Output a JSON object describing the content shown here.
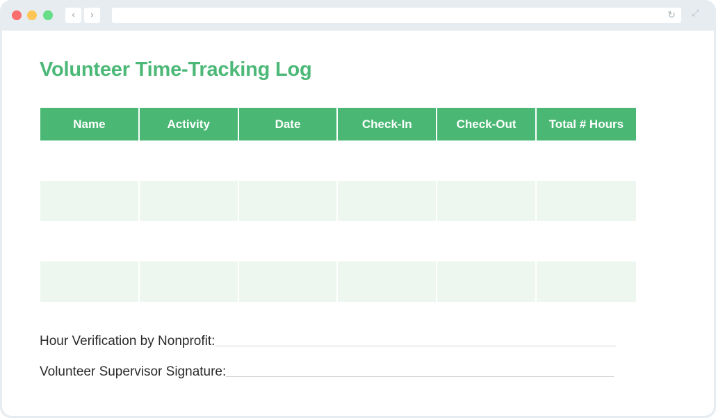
{
  "browser": {
    "back_icon": "‹",
    "forward_icon": "›",
    "reload_icon": "↻",
    "expand_icon": "⤢",
    "url": ""
  },
  "document": {
    "title": "Volunteer Time-Tracking Log",
    "accent_color": "#4ab874",
    "table": {
      "columns": [
        "Name",
        "Activity",
        "Date",
        "Check-In",
        "Check-Out",
        "Total # Hours"
      ],
      "rows": [
        [
          "",
          "",
          "",
          "",
          "",
          ""
        ],
        [
          "",
          "",
          "",
          "",
          "",
          ""
        ],
        [
          "",
          "",
          "",
          "",
          "",
          ""
        ],
        [
          "",
          "",
          "",
          "",
          "",
          ""
        ]
      ]
    },
    "signatures": [
      {
        "label": "Hour Verification by Nonprofit:"
      },
      {
        "label": "Volunteer Supervisor Signature:"
      }
    ]
  }
}
